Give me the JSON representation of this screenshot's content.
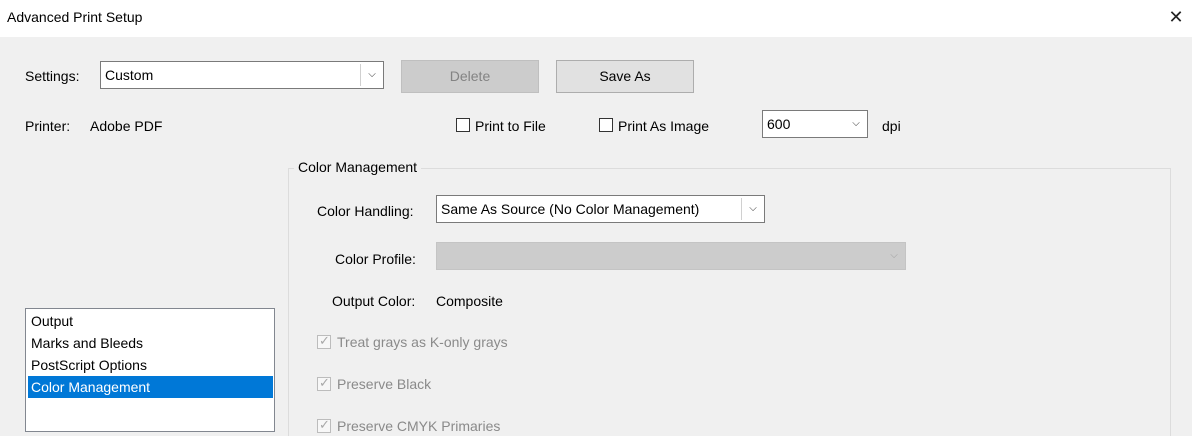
{
  "window": {
    "title": "Advanced Print Setup",
    "close_glyph": "✕"
  },
  "settings": {
    "label": "Settings:",
    "value": "Custom",
    "delete_label": "Delete",
    "save_as_label": "Save As"
  },
  "printer": {
    "label": "Printer:",
    "value": "Adobe PDF",
    "print_to_file_label": "Print to File",
    "print_to_file_checked": false,
    "print_as_image_label": "Print As Image",
    "print_as_image_checked": false,
    "dpi_value": "600",
    "dpi_label": "dpi"
  },
  "sidebar": {
    "items": [
      {
        "label": "Output",
        "selected": false
      },
      {
        "label": "Marks and Bleeds",
        "selected": false
      },
      {
        "label": "PostScript Options",
        "selected": false
      },
      {
        "label": "Color Management",
        "selected": true
      }
    ]
  },
  "color_management": {
    "group_title": "Color Management",
    "color_handling_label": "Color Handling:",
    "color_handling_value": "Same As Source (No Color Management)",
    "color_profile_label": "Color Profile:",
    "color_profile_value": "",
    "output_color_label": "Output Color:",
    "output_color_value": "Composite",
    "treat_grays_label": "Treat grays as K-only grays",
    "treat_grays_checked": true,
    "preserve_black_label": "Preserve Black",
    "preserve_black_checked": true,
    "preserve_cmyk_label": "Preserve CMYK Primaries",
    "preserve_cmyk_checked": true
  },
  "icons": {
    "dropdown": "chevron-down-icon",
    "close": "close-icon",
    "check": "checkmark-icon"
  },
  "colors": {
    "selection": "#0078d7",
    "window_bg": "#f0f0f0",
    "disabled_bg": "#cccccc"
  }
}
